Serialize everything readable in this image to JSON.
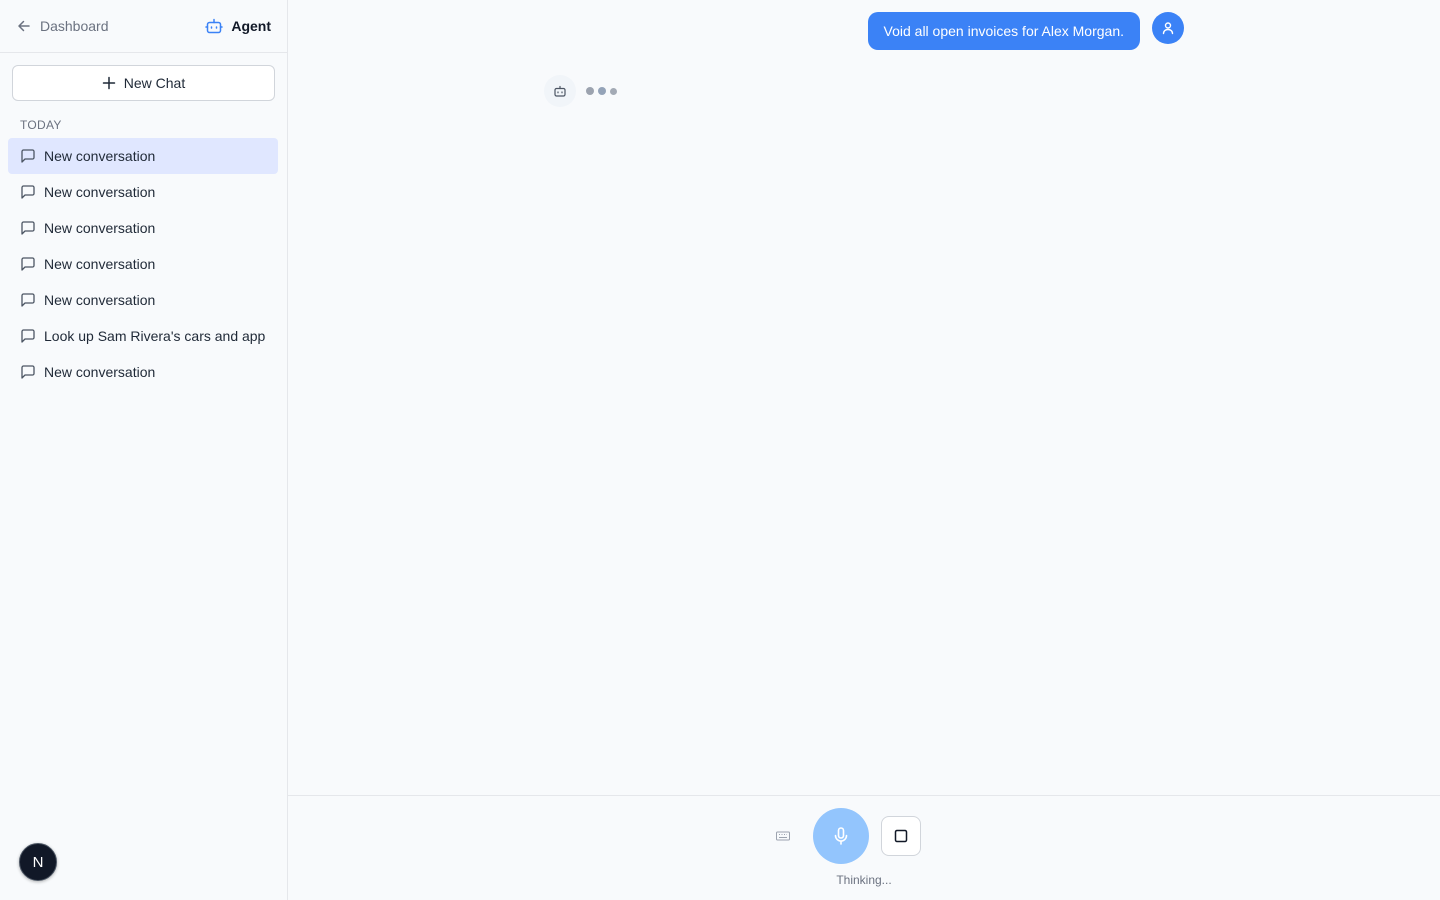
{
  "sidebar": {
    "back_label": "Dashboard",
    "agent_label": "Agent",
    "new_chat_label": "New Chat",
    "section_label": "TODAY",
    "conversations": [
      {
        "title": "New conversation",
        "active": true
      },
      {
        "title": "New conversation",
        "active": false
      },
      {
        "title": "New conversation",
        "active": false
      },
      {
        "title": "New conversation",
        "active": false
      },
      {
        "title": "New conversation",
        "active": false
      },
      {
        "title": "Look up Sam Rivera's cars and appo",
        "active": false
      },
      {
        "title": "New conversation",
        "active": false
      }
    ],
    "user_initial": "N"
  },
  "chat": {
    "user_message": "Void all open invoices for Alex Morgan."
  },
  "composer": {
    "status": "Thinking..."
  },
  "colors": {
    "accent": "#3b82f6",
    "mic_active": "#93c5fd",
    "active_item": "#e0e7ff"
  }
}
